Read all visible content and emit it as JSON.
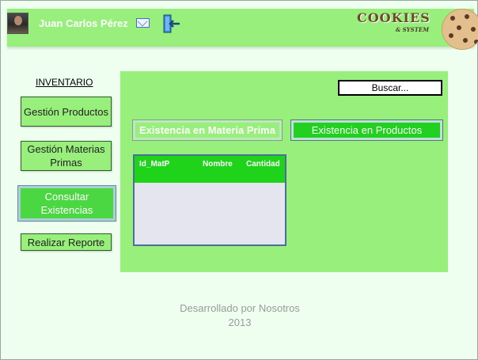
{
  "header": {
    "user_name": "Juan Carlos Pérez",
    "logo_main": "COOKIES",
    "logo_sub": "& SYSTEM",
    "icons": [
      "avatar",
      "mail-icon",
      "exit-icon",
      "cookie-icon"
    ]
  },
  "sidebar": {
    "title": "INVENTARIO",
    "items": [
      {
        "label": "Gestión Productos",
        "active": false
      },
      {
        "label": "Gestión Materias Primas",
        "active": false
      },
      {
        "label": "Consultar Existencias",
        "active": true
      },
      {
        "label": "Realizar Reporte",
        "active": false
      }
    ]
  },
  "main": {
    "search_label": "Buscar...",
    "tabs": [
      {
        "label": "Existencia en Materia Prima",
        "selected": true
      },
      {
        "label": "Existencia en Productos",
        "selected": false
      }
    ],
    "table": {
      "columns": [
        "Id_MatP",
        "Nombre",
        "Cantidad"
      ],
      "rows": []
    }
  },
  "footer": {
    "line1": "Desarrollado por Nosotros",
    "line2": "2013"
  },
  "colors": {
    "page_bg": "#eefff0",
    "panel_green": "#99ef7b",
    "accent_green": "#22d11f",
    "table_body": "#e5e5f0"
  }
}
